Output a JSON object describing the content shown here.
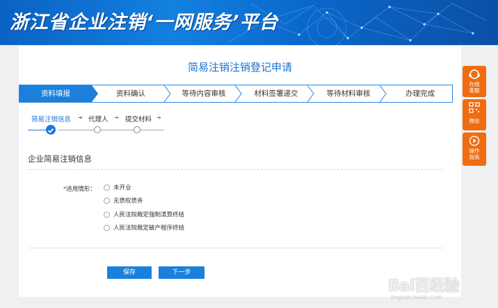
{
  "banner": {
    "title": "浙江省企业注销‘一网服务’平台"
  },
  "page": {
    "title": "简易注销注销登记申请"
  },
  "steps": [
    {
      "label": "资料填报",
      "active": true
    },
    {
      "label": "资料确认",
      "active": false
    },
    {
      "label": "等待内容审核",
      "active": false
    },
    {
      "label": "材料签署递交",
      "active": false
    },
    {
      "label": "等待材料审核",
      "active": false
    },
    {
      "label": "办理完成",
      "active": false
    }
  ],
  "substeps": [
    {
      "label": "简易注销信息",
      "active": true,
      "done": true
    },
    {
      "label": "代理人",
      "active": false,
      "done": false
    },
    {
      "label": "提交材料",
      "active": false,
      "done": false
    }
  ],
  "section": {
    "title": "企业简易注销信息"
  },
  "form": {
    "required_mark": "*",
    "label": "适用情形：",
    "options": [
      "未开业",
      "无债权债务",
      "人民法院裁定强制清算终结",
      "人民法院裁定破产程序终结"
    ]
  },
  "buttons": {
    "save": "保存",
    "next": "下一步"
  },
  "side": {
    "service": "在线客服",
    "wechat": "微信",
    "guide": "操作指南"
  },
  "watermark": {
    "logo": "Bai百经验",
    "url": "jingyan.baidu.com"
  },
  "colors": {
    "primary": "#1a80dc",
    "accent": "#ef6c12",
    "required": "#e02020"
  }
}
